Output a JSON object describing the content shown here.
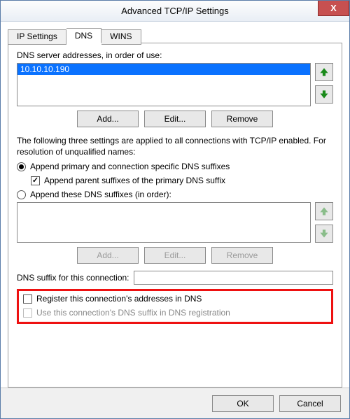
{
  "window": {
    "title": "Advanced TCP/IP Settings",
    "close_glyph": "X"
  },
  "tabs": {
    "ip_settings": "IP Settings",
    "dns": "DNS",
    "wins": "WINS",
    "active": "dns"
  },
  "dns": {
    "servers_label": "DNS server addresses, in order of use:",
    "servers": [
      "10.10.10.190"
    ],
    "add_btn": "Add...",
    "edit_btn": "Edit...",
    "remove_btn": "Remove",
    "explain": "The following three settings are applied to all connections with TCP/IP enabled. For resolution of unqualified names:",
    "radio_primary": "Append primary and connection specific DNS suffixes",
    "check_parent": "Append parent suffixes of the primary DNS suffix",
    "radio_these": "Append these DNS suffixes (in order):",
    "radio_selected": "primary",
    "check_parent_checked": true,
    "suffix_list": [],
    "add2_btn": "Add...",
    "edit2_btn": "Edit...",
    "remove2_btn": "Remove",
    "suffix_conn_label": "DNS suffix for this connection:",
    "suffix_conn_value": "",
    "check_register": "Register this connection's addresses in DNS",
    "check_register_checked": false,
    "check_use_suffix": "Use this connection's DNS suffix in DNS registration",
    "check_use_suffix_checked": false
  },
  "footer": {
    "ok": "OK",
    "cancel": "Cancel"
  }
}
